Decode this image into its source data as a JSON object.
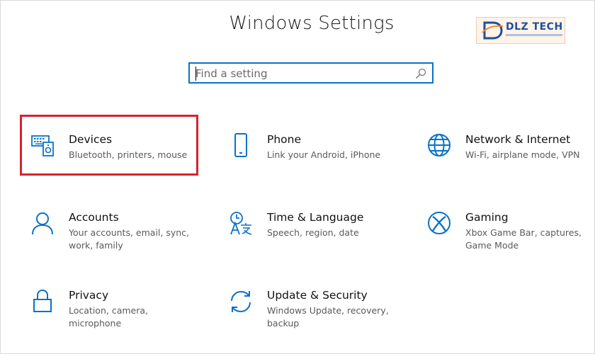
{
  "window": {
    "title": "Windows Settings"
  },
  "search": {
    "placeholder": "Find a setting"
  },
  "branding": {
    "logo_text": "DLZ TECH"
  },
  "tiles": [
    {
      "name": "Devices",
      "desc": "Bluetooth, printers, mouse",
      "icon": "devices-icon"
    },
    {
      "name": "Phone",
      "desc": "Link your Android, iPhone",
      "icon": "phone-icon"
    },
    {
      "name": "Network & Internet",
      "desc": "Wi-Fi, airplane mode, VPN",
      "icon": "globe-icon"
    },
    {
      "name": "Accounts",
      "desc": "Your accounts, email, sync, work, family",
      "icon": "person-icon"
    },
    {
      "name": "Time & Language",
      "desc": "Speech, region, date",
      "icon": "time-language-icon"
    },
    {
      "name": "Gaming",
      "desc": "Xbox Game Bar, captures, Game Mode",
      "icon": "xbox-icon"
    },
    {
      "name": "Privacy",
      "desc": "Location, camera, microphone",
      "icon": "lock-icon"
    },
    {
      "name": "Update & Security",
      "desc": "Windows Update, recovery, backup",
      "icon": "sync-icon"
    }
  ],
  "colors": {
    "accent": "#0a72c9",
    "highlight": "#d8222f"
  }
}
